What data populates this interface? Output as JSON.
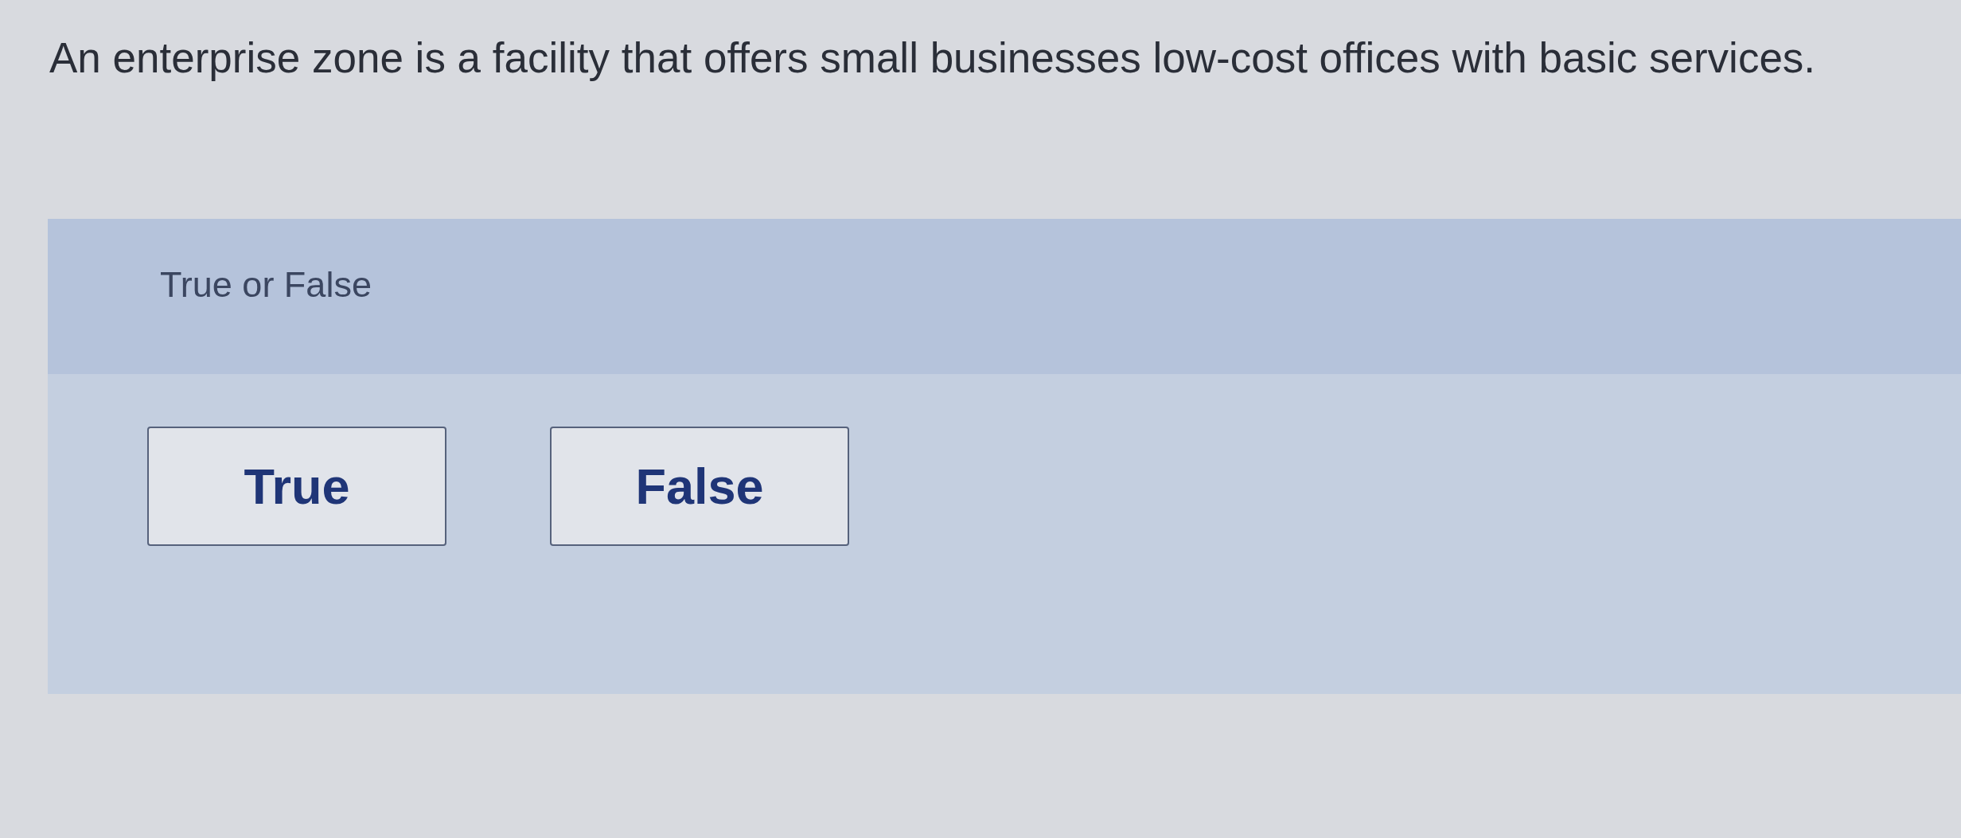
{
  "question": {
    "text": "An enterprise zone is a facility that offers small businesses low-cost offices with basic services."
  },
  "prompt": {
    "text": "True or False"
  },
  "options": [
    {
      "label": "True",
      "selected": false
    },
    {
      "label": "False",
      "selected": false
    }
  ]
}
